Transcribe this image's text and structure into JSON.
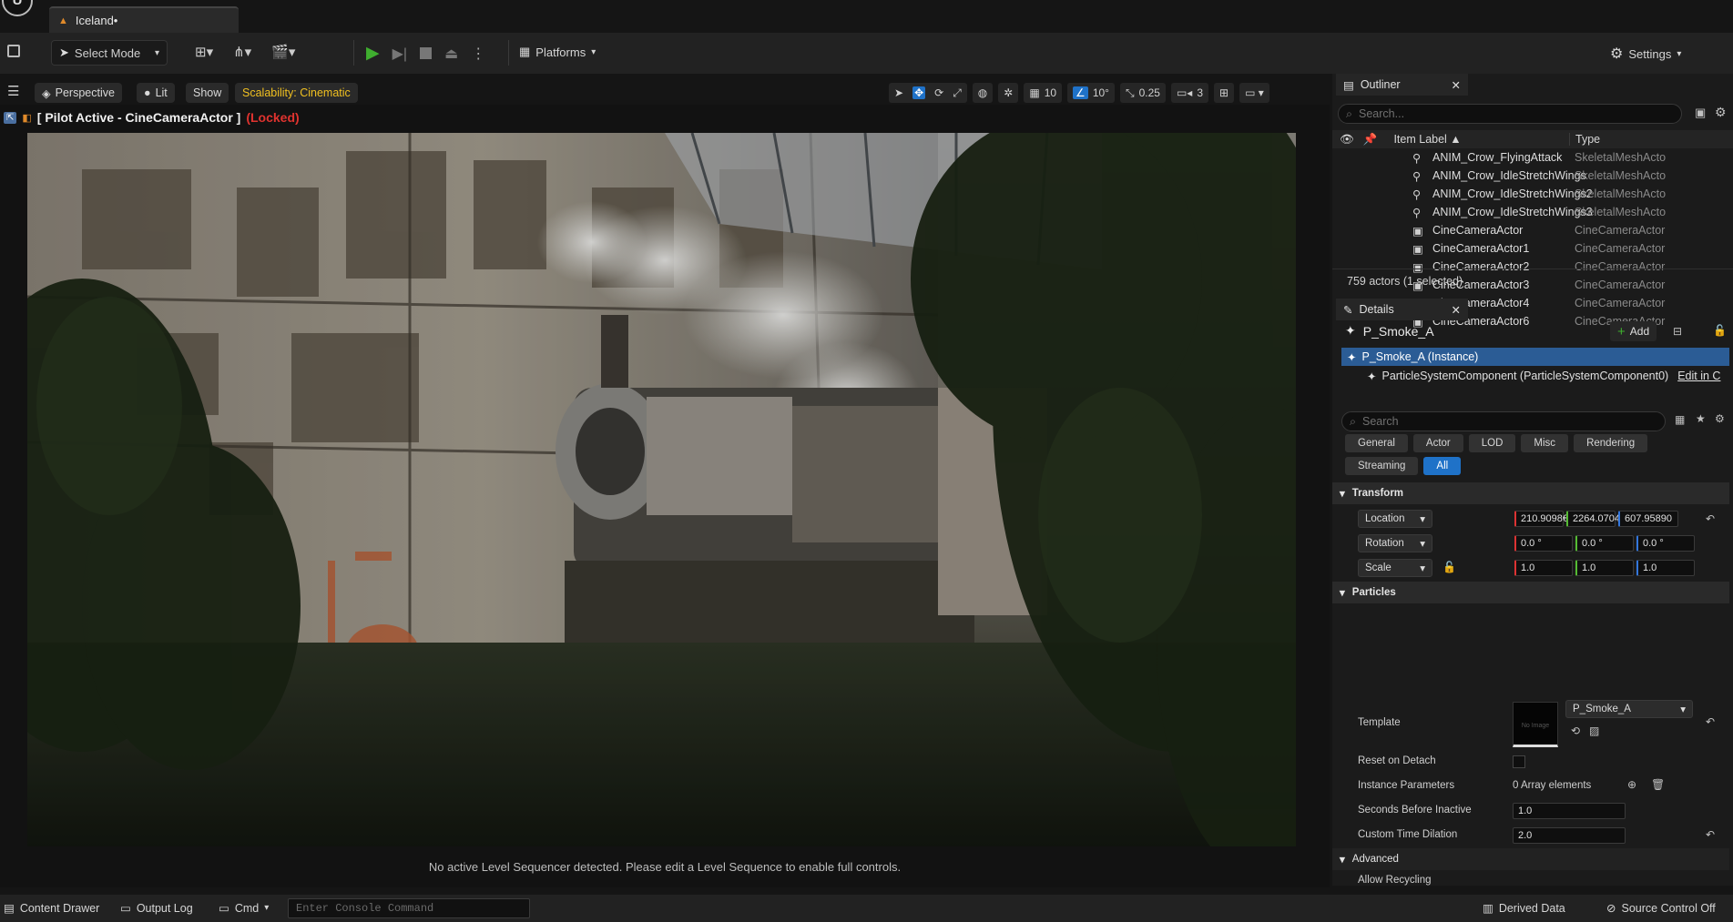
{
  "title_tab": {
    "label": "Iceland•"
  },
  "toolbar": {
    "select_mode": "Select Mode",
    "platforms": "Platforms",
    "settings": "Settings"
  },
  "viewport": {
    "perspective": "Perspective",
    "lit": "Lit",
    "show": "Show",
    "scalability": "Scalability: Cinematic",
    "grid_snap": "10",
    "rot_snap": "10°",
    "scale_snap": "0.25",
    "cam_speed": "3",
    "pilot_text": "[ Pilot Active - CineCameraActor ]",
    "locked": "(Locked)",
    "sequencer_msg": "No active Level Sequencer detected. Please edit a Level Sequence to enable full controls."
  },
  "outliner": {
    "tab": "Outliner",
    "search_placeholder": "Search...",
    "col_label": "Item Label ▲",
    "col_type": "Type",
    "rows": [
      {
        "label": "ANIM_Crow_FlyingAttack",
        "type": "SkeletalMeshActo"
      },
      {
        "label": "ANIM_Crow_IdleStretchWings",
        "type": "SkeletalMeshActo"
      },
      {
        "label": "ANIM_Crow_IdleStretchWings2",
        "type": "SkeletalMeshActo"
      },
      {
        "label": "ANIM_Crow_IdleStretchWings3",
        "type": "SkeletalMeshActo"
      },
      {
        "label": "CineCameraActor",
        "type": "CineCameraActor"
      },
      {
        "label": "CineCameraActor1",
        "type": "CineCameraActor"
      },
      {
        "label": "CineCameraActor2",
        "type": "CineCameraActor"
      },
      {
        "label": "CineCameraActor3",
        "type": "CineCameraActor"
      },
      {
        "label": "CineCameraActor4",
        "type": "CineCameraActor"
      },
      {
        "label": "CineCameraActor6",
        "type": "CineCameraActor"
      }
    ],
    "count": "759 actors (1 selected)"
  },
  "details": {
    "tab": "Details",
    "actor_name": "P_Smoke_A",
    "add_label": "Add",
    "instance": "P_Smoke_A (Instance)",
    "component": "ParticleSystemComponent (ParticleSystemComponent0)",
    "edit_link": "Edit in C",
    "search_placeholder": "Search",
    "filters": [
      "General",
      "Actor",
      "LOD",
      "Misc",
      "Rendering",
      "Streaming",
      "All"
    ],
    "transform_header": "Transform",
    "location_label": "Location",
    "location": [
      "210.9098€",
      "2264.0704",
      "607.95890"
    ],
    "rotation_label": "Rotation",
    "rotation": [
      "0.0 °",
      "0.0 °",
      "0.0 °"
    ],
    "scale_label": "Scale",
    "scale": [
      "1.0",
      "1.0",
      "1.0"
    ],
    "particles_header": "Particles",
    "template_label": "Template",
    "template_value": "P_Smoke_A",
    "thumb_text": "No Image",
    "reset_label": "Reset on Detach",
    "instance_params_label": "Instance Parameters",
    "instance_params_value": "0 Array elements",
    "seconds_label": "Seconds Before Inactive",
    "seconds_value": "1.0",
    "dilation_label": "Custom Time Dilation",
    "dilation_value": "2.0",
    "advanced_header": "Advanced",
    "allow_recycling": "Allow Recycling"
  },
  "statusbar": {
    "content_drawer": "Content Drawer",
    "output_log": "Output Log",
    "cmd": "Cmd",
    "console_placeholder": "Enter Console Command",
    "derived_data": "Derived Data",
    "source_control": "Source Control Off"
  },
  "colors": {
    "accent_blue": "#1f72c8",
    "play_green": "#3fae2f",
    "locked_red": "#e0332f",
    "scalability_yellow": "#f0c020"
  }
}
